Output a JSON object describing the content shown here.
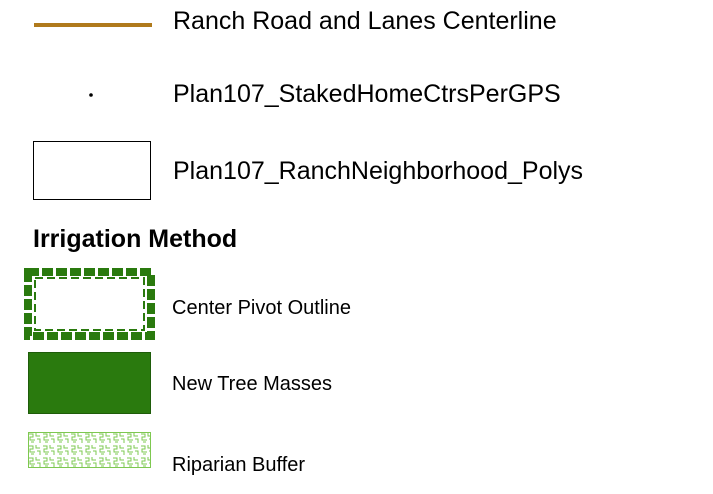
{
  "legend": {
    "items": [
      {
        "label": "Ranch Road and Lanes Centerline",
        "symbol": "line",
        "color": "#b07a1c"
      },
      {
        "label": "Plan107_StakedHomeCtrsPerGPS",
        "symbol": "point",
        "color": "#000000"
      },
      {
        "label": "Plan107_RanchNeighborhood_Polys",
        "symbol": "polygon-outline",
        "color": "#000000"
      }
    ],
    "group": {
      "title": "Irrigation Method",
      "items": [
        {
          "label": "Center Pivot Outline",
          "symbol": "dashed-outline",
          "color": "#2a7a0e"
        },
        {
          "label": "New Tree Masses",
          "symbol": "solid-fill",
          "color": "#2a7a0e"
        },
        {
          "label": "Riparian Buffer",
          "symbol": "pattern-fill",
          "color": "#7ec850"
        }
      ]
    }
  }
}
